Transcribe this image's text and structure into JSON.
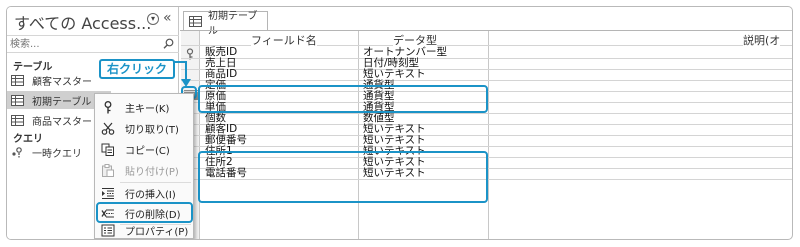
{
  "nav": {
    "title": "すべての Access...",
    "search_placeholder": "検索...",
    "groups": [
      {
        "label": "テーブル",
        "items": [
          {
            "label": "顧客マスター",
            "selected": false
          },
          {
            "label": "初期テーブル",
            "selected": true
          },
          {
            "label": "商品マスター",
            "selected": false
          }
        ]
      },
      {
        "label": "クエリ",
        "items": [
          {
            "label": "一時クエリ",
            "selected": false
          }
        ]
      }
    ]
  },
  "context_menu": {
    "items": [
      {
        "label": "主キー(K)",
        "icon": "key-icon",
        "enabled": true
      },
      {
        "label": "切り取り(T)",
        "icon": "scissors-icon",
        "enabled": true
      },
      {
        "label": "コピー(C)",
        "icon": "copy-icon",
        "enabled": true
      },
      {
        "label": "貼り付け(P)",
        "icon": "paste-icon",
        "enabled": false
      },
      {
        "label": "行の挿入(I)",
        "icon": "insert-row-icon",
        "enabled": true
      },
      {
        "label": "行の削除(D)",
        "icon": "delete-row-icon",
        "enabled": true,
        "highlighted": true
      },
      {
        "label": "プロパティ(P)",
        "icon": "properties-icon",
        "enabled": true
      }
    ]
  },
  "callout": {
    "label": "右クリック"
  },
  "tab": {
    "label": "初期テーブル"
  },
  "design_grid": {
    "headers": {
      "field_name": "フィールド名",
      "data_type": "データ型",
      "description": "説明(オ"
    },
    "rows": [
      {
        "field": "販売ID",
        "type": "オートナンバー型",
        "primary_key": true
      },
      {
        "field": "売上日",
        "type": "日付/時刻型"
      },
      {
        "field": "商品ID",
        "type": "短いテキスト"
      },
      {
        "field": "定価",
        "type": "通貨型",
        "selected": true
      },
      {
        "field": "原価",
        "type": "通貨型",
        "selected": true
      },
      {
        "field": "単価",
        "type": "通貨型"
      },
      {
        "field": "個数",
        "type": "数値型"
      },
      {
        "field": "顧客ID",
        "type": "短いテキスト"
      },
      {
        "field": "郵便番号",
        "type": "短いテキスト"
      },
      {
        "field": "住所1",
        "type": "短いテキスト"
      },
      {
        "field": "住所2",
        "type": "短いテキスト"
      },
      {
        "field": "電話番号",
        "type": "短いテキスト"
      }
    ]
  },
  "colors": {
    "highlight": "#1b93c7",
    "selected_nav": "#cfcfcf"
  }
}
